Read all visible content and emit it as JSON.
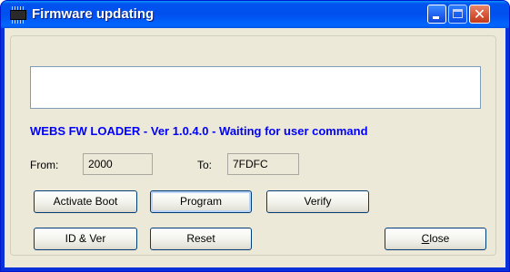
{
  "window": {
    "title": "Firmware updating",
    "icon": "chip-icon"
  },
  "titlebar_buttons": {
    "minimize": "minimize-icon",
    "maximize": "maximize-icon",
    "close_glyph": "✕"
  },
  "output": {
    "value": ""
  },
  "status_text": "WEBS FW LOADER - Ver 1.0.4.0 - Waiting for user command",
  "range": {
    "from_label": "From:",
    "from_value": "2000",
    "to_label": "To:",
    "to_value": "7FDFC"
  },
  "buttons": {
    "activate_boot": "Activate Boot",
    "program": "Program",
    "verify": "Verify",
    "id_ver": "ID & Ver",
    "reset": "Reset",
    "close_mnemonic": "C",
    "close_rest": "lose"
  },
  "colors": {
    "status_text": "#0000ff",
    "titlebar": "#0053ee",
    "client_bg": "#ece9d8"
  }
}
